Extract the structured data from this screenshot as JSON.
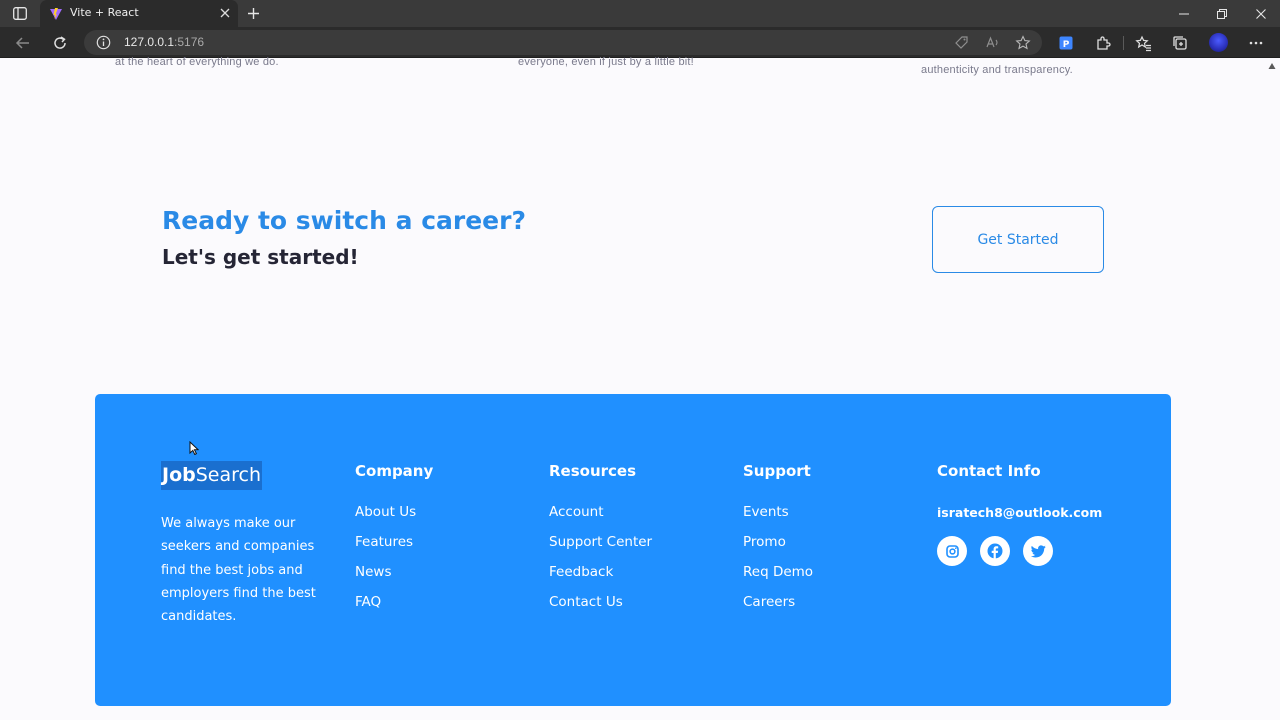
{
  "browser": {
    "tab_title": "Vite + React",
    "url_host": "127.0.0.1",
    "url_port": ":5176"
  },
  "values_section": {
    "descriptions": [
      "at the heart of everything we do.",
      "everyone, even if just by a little bit!",
      "authenticity and transparency."
    ]
  },
  "cta": {
    "title": "Ready to switch a career?",
    "subtitle": "Let's get started!",
    "button_label": "Get Started"
  },
  "footer": {
    "logo_bold": "Job",
    "logo_regular": "Search",
    "tagline": "We always make our seekers and companies find the best jobs and employers find the best candidates.",
    "columns": [
      {
        "heading": "Company",
        "links": [
          "About Us",
          "Features",
          "News",
          "FAQ"
        ]
      },
      {
        "heading": "Resources",
        "links": [
          "Account",
          "Support Center",
          "Feedback",
          "Contact Us"
        ]
      },
      {
        "heading": "Support",
        "links": [
          "Events",
          "Promo",
          "Req Demo",
          "Careers"
        ]
      }
    ],
    "contact": {
      "heading": "Contact Info",
      "email": "isratech8@outlook.com",
      "socials": [
        "instagram-icon",
        "facebook-icon",
        "twitter-icon"
      ]
    }
  },
  "colors": {
    "primary": "#2a8ae6",
    "footer_bg": "#2090ff",
    "dark_text": "#252535",
    "chrome_bg": "#2b2b2b"
  }
}
